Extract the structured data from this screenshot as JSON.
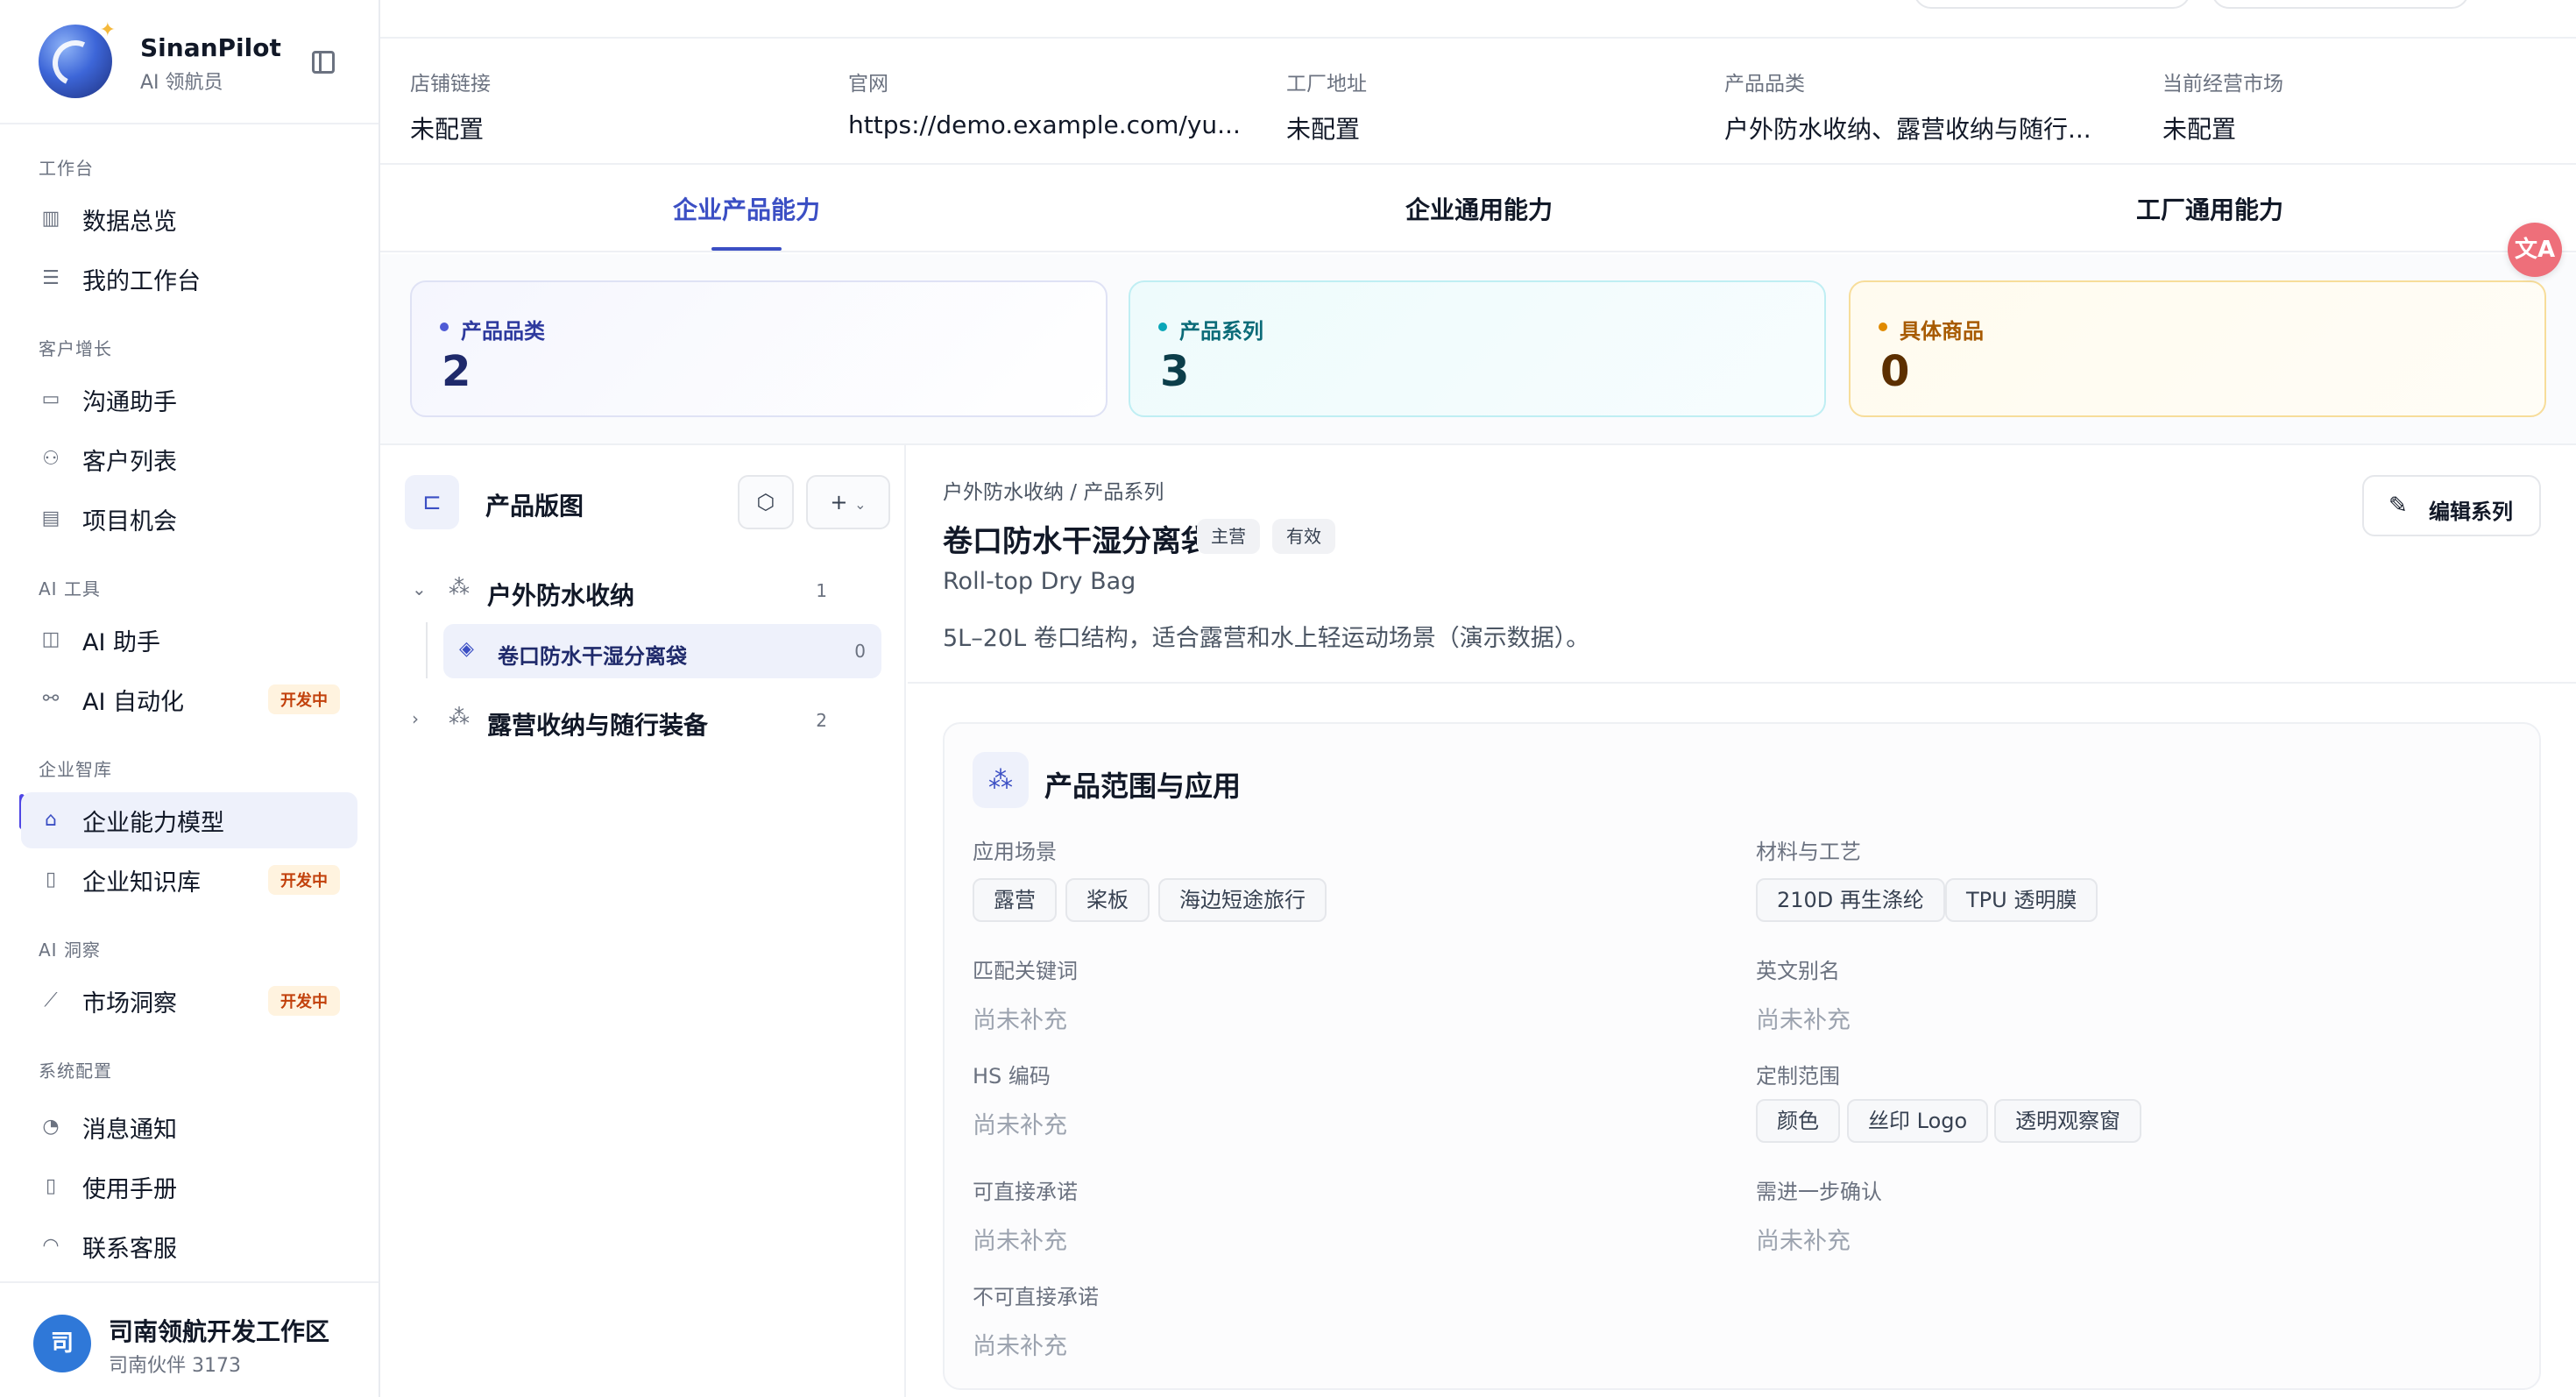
{
  "brand": {
    "name": "SinanPilot",
    "subtitle": "AI 领航员"
  },
  "sidebar": {
    "sections": [
      {
        "title": "工作台"
      },
      {
        "title": "客户增长"
      },
      {
        "title": "AI 工具"
      },
      {
        "title": "企业智库"
      },
      {
        "title": "AI 洞察"
      },
      {
        "title": "系统配置"
      }
    ],
    "items": [
      {
        "label": "数据总览",
        "icon": "bar-chart-icon"
      },
      {
        "label": "我的工作台",
        "icon": "checklist-icon"
      },
      {
        "label": "沟通助手",
        "icon": "chat-icon"
      },
      {
        "label": "客户列表",
        "icon": "users-icon"
      },
      {
        "label": "项目机会",
        "icon": "briefcase-icon"
      },
      {
        "label": "AI 助手",
        "icon": "robot-icon"
      },
      {
        "label": "AI 自动化",
        "icon": "workflow-icon",
        "badge": "开发中"
      },
      {
        "label": "企业能力模型",
        "icon": "store-icon",
        "active": true
      },
      {
        "label": "企业知识库",
        "icon": "book-icon",
        "badge": "开发中"
      },
      {
        "label": "市场洞察",
        "icon": "line-chart-icon",
        "badge": "开发中"
      },
      {
        "label": "消息通知",
        "icon": "bell-icon"
      },
      {
        "label": "使用手册",
        "icon": "manual-icon"
      },
      {
        "label": "联系客服",
        "icon": "headset-icon"
      }
    ]
  },
  "workspace": {
    "avatar": "司",
    "name": "司南领航开发工作区",
    "sub": "司南伙伴 3173"
  },
  "info": [
    {
      "label": "店铺链接",
      "value": "未配置"
    },
    {
      "label": "官网",
      "value": "https://demo.example.com/yu..."
    },
    {
      "label": "工厂地址",
      "value": "未配置"
    },
    {
      "label": "产品品类",
      "value": "户外防水收纳、露营收纳与随行..."
    },
    {
      "label": "当前经营市场",
      "value": "未配置"
    }
  ],
  "tabs": [
    {
      "label": "企业产品能力",
      "active": true
    },
    {
      "label": "企业通用能力"
    },
    {
      "label": "工厂通用能力"
    }
  ],
  "stats": [
    {
      "label": "产品品类",
      "value": "2",
      "color": "#4f5bd5"
    },
    {
      "label": "产品系列",
      "value": "3",
      "color": "#0aa6b8"
    },
    {
      "label": "具体商品",
      "value": "0",
      "color": "#e08a00"
    }
  ],
  "tree": {
    "title": "产品版图",
    "add_label": "+",
    "nodes": [
      {
        "label": "户外防水收纳",
        "count": "1",
        "expanded": true
      },
      {
        "label": "卷口防水干湿分离袋",
        "count": "0",
        "selected": true
      },
      {
        "label": "露营收纳与随行装备",
        "count": "2",
        "expanded": false
      }
    ]
  },
  "detail": {
    "breadcrumb": "户外防水收纳 / 产品系列",
    "title": "卷口防水干湿分离袋",
    "tags": [
      "主营",
      "有效"
    ],
    "english_name": "Roll-top Dry Bag",
    "description": "5L–20L 卷口结构，适合露营和水上轻运动场景（演示数据）。",
    "edit_label": "编辑系列"
  },
  "scope": {
    "title": "产品范围与应用",
    "empty_text": "尚未补充",
    "fields": {
      "scenarios": {
        "label": "应用场景",
        "chips": [
          "露营",
          "桨板",
          "海边短途旅行"
        ]
      },
      "materials": {
        "label": "材料与工艺",
        "chips": [
          "210D 再生涤纶",
          "TPU 透明膜"
        ]
      },
      "keywords": {
        "label": "匹配关键词"
      },
      "alias": {
        "label": "英文别名"
      },
      "hs_code": {
        "label": "HS 编码"
      },
      "custom": {
        "label": "定制范围",
        "chips": [
          "颜色",
          "丝印 Logo",
          "透明观察窗"
        ]
      },
      "direct": {
        "label": "可直接承诺"
      },
      "confirm": {
        "label": "需进一步确认"
      },
      "not_direct": {
        "label": "不可直接承诺"
      }
    }
  },
  "translate_fab": "文A"
}
